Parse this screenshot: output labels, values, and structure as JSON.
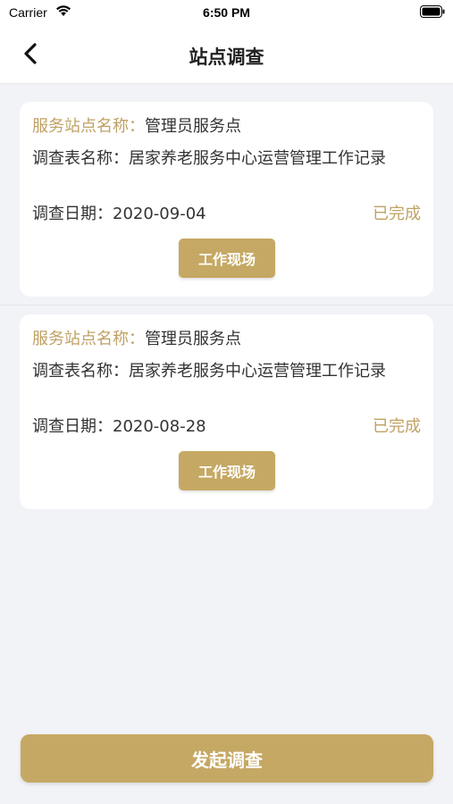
{
  "status_bar": {
    "carrier": "Carrier",
    "time": "6:50 PM"
  },
  "nav": {
    "title": "站点调查"
  },
  "records": [
    {
      "station_label": "服务站点名称：",
      "station_value": "管理员服务点",
      "form_label": "调查表名称：",
      "form_value": "居家养老服务中心运营管理工作记录",
      "date_label": "调查日期：",
      "date_value": "2020-09-04",
      "status": "已完成",
      "button_label": "工作现场"
    },
    {
      "station_label": "服务站点名称：",
      "station_value": "管理员服务点",
      "form_label": "调查表名称：",
      "form_value": "居家养老服务中心运营管理工作记录",
      "date_label": "调查日期：",
      "date_value": "2020-08-28",
      "status": "已完成",
      "button_label": "工作现场"
    }
  ],
  "footer": {
    "initiate_label": "发起调查"
  },
  "colors": {
    "accent": "#c5a863",
    "accent_text": "#bfa163",
    "background": "#f2f3f7"
  },
  "icons": [
    "wifi-icon",
    "battery-icon",
    "back-arrow-icon"
  ]
}
